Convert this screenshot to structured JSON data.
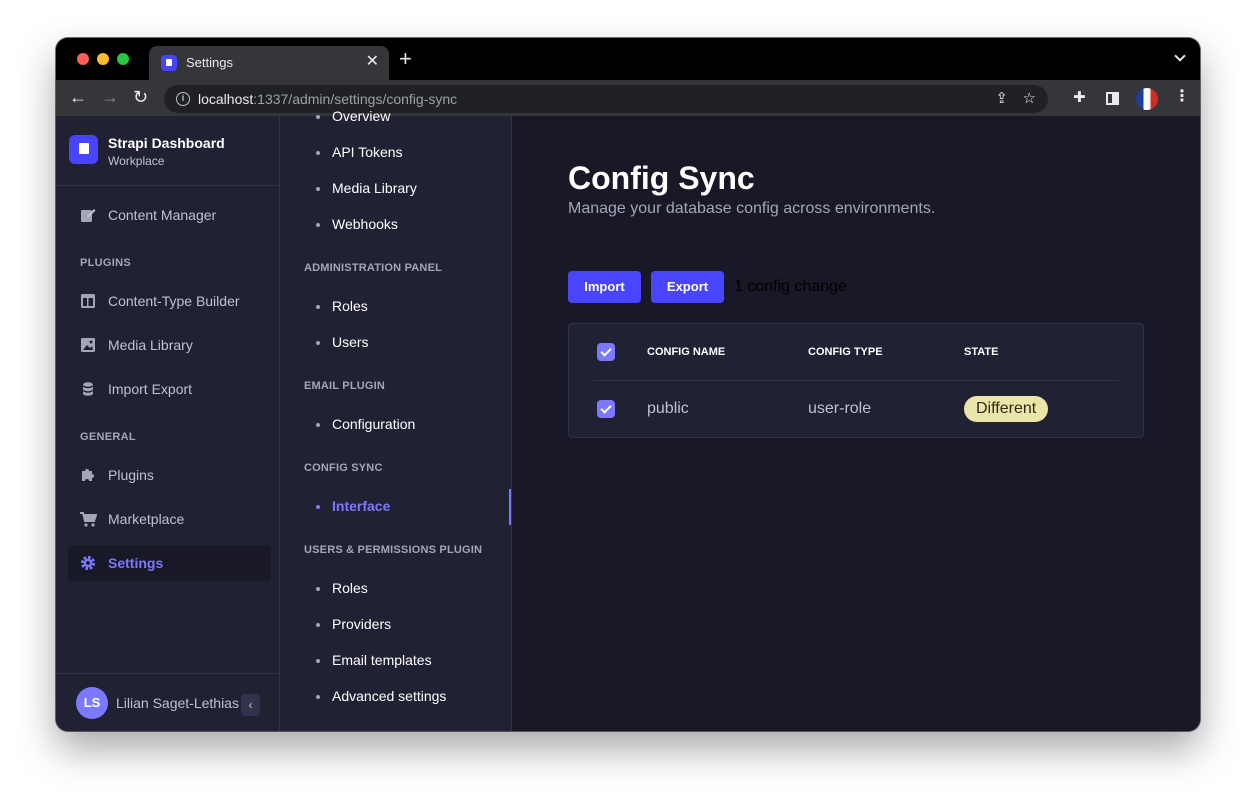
{
  "browser": {
    "tab_title": "Settings",
    "tab_close": "✕",
    "new_tab": "+",
    "url_host": "localhost",
    "url_rest": ":1337/admin/settings/config-sync"
  },
  "brand": {
    "title": "Strapi Dashboard",
    "subtitle": "Workplace"
  },
  "main_nav": {
    "content_manager": "Content Manager",
    "plugins_section": "PLUGINS",
    "plugins": [
      "Content-Type Builder",
      "Media Library",
      "Import Export"
    ],
    "general_section": "GENERAL",
    "general": [
      "Plugins",
      "Marketplace",
      "Settings"
    ],
    "active": "Settings"
  },
  "user": {
    "initials": "LS",
    "name": "Lilian Saget-Lethias"
  },
  "sub_nav": {
    "global_links": [
      "Overview",
      "API Tokens",
      "Media Library",
      "Webhooks"
    ],
    "admin_section": "ADMINISTRATION PANEL",
    "admin_links": [
      "Roles",
      "Users"
    ],
    "email_section": "EMAIL PLUGIN",
    "email_links": [
      "Configuration"
    ],
    "config_sync_section": "CONFIG SYNC",
    "config_sync_links": [
      "Interface"
    ],
    "up_section": "USERS & PERMISSIONS PLUGIN",
    "up_links": [
      "Roles",
      "Providers",
      "Email templates",
      "Advanced settings"
    ]
  },
  "page": {
    "title": "Config Sync",
    "subtitle": "Manage your database config across environments.",
    "import_label": "Import",
    "export_label": "Export",
    "change_count": "1 config change"
  },
  "table": {
    "headers": [
      "CONFIG NAME",
      "CONFIG TYPE",
      "STATE"
    ],
    "rows": [
      {
        "name": "public",
        "type": "user-role",
        "state": "Different",
        "checked": true
      }
    ]
  },
  "help": {
    "label": "?"
  },
  "colors": {
    "accent": "#4945ff",
    "accent_light": "#7b79ff",
    "nav_bg": "#212134",
    "content_bg": "#181826",
    "badge_bg": "#eae5a8"
  }
}
